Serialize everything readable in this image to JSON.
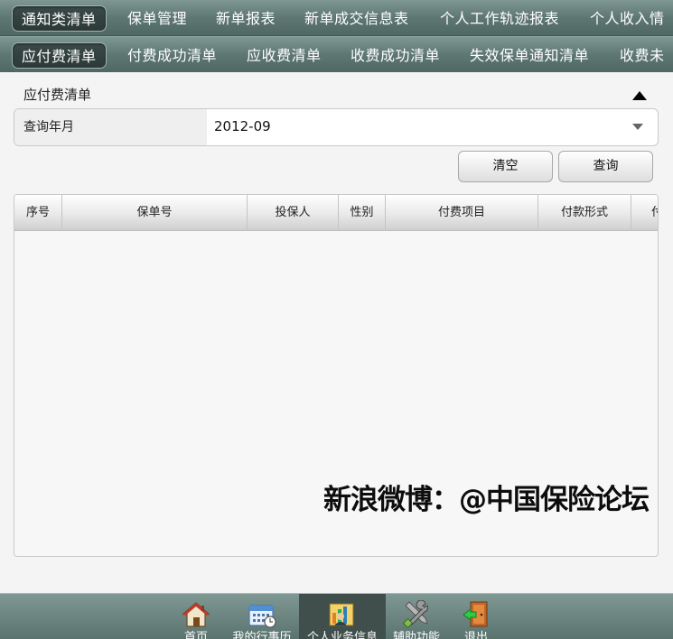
{
  "tabs_row1": [
    "通知类清单",
    "保单管理",
    "新单报表",
    "新单成交信息表",
    "个人工作轨迹报表",
    "个人收入情"
  ],
  "tabs_row2": [
    "应付费清单",
    "付费成功清单",
    "应收费清单",
    "收费成功清单",
    "失效保单通知清单",
    "收费未"
  ],
  "section": {
    "title": "应付费清单"
  },
  "form": {
    "label": "查询年月",
    "value": "2012-09"
  },
  "buttons": {
    "clear": "清空",
    "query": "查询"
  },
  "table": {
    "headers": [
      "序号",
      "保单号",
      "投保人",
      "性别",
      "付费项目",
      "付款形式",
      "付"
    ]
  },
  "watermark": "新浪微博：@中国保险论坛",
  "bottom_nav": [
    {
      "label": "首页",
      "icon": "home-icon"
    },
    {
      "label": "我的行事历",
      "icon": "calendar-icon"
    },
    {
      "label": "个人业务信息",
      "icon": "business-info-icon"
    },
    {
      "label": "辅助功能",
      "icon": "tools-icon"
    },
    {
      "label": "退出",
      "icon": "exit-icon"
    }
  ]
}
